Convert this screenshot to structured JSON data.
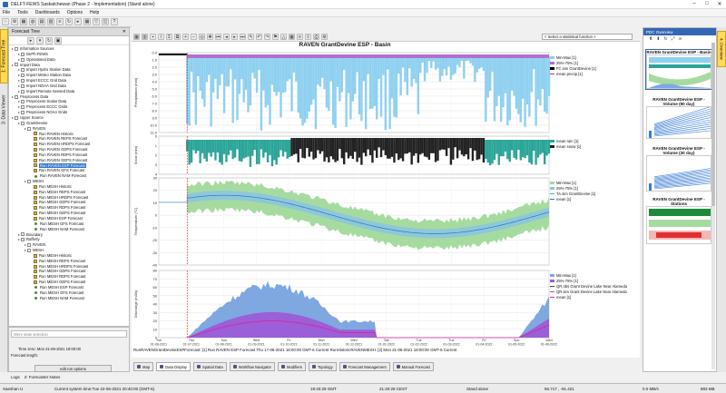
{
  "window": {
    "title": "DELFT-FEWS Saskatchewan (Phase 2 - Implementation) (Stand alone)",
    "controls": [
      "–",
      "□",
      "✕"
    ]
  },
  "menu": [
    "File",
    "Tools",
    "Dashboards",
    "Options",
    "Help"
  ],
  "left_tabs": {
    "forecast_tree": "1: Forecast Tree",
    "data_viewer": "3: Data Viewer"
  },
  "tree": {
    "header": "Forecast Tree",
    "rows": [
      {
        "d": 0,
        "t": "Information Sources"
      },
      {
        "d": 1,
        "t": "DePh-FEWS"
      },
      {
        "d": 1,
        "t": "Operational Data"
      },
      {
        "d": 0,
        "t": "Import Data"
      },
      {
        "d": 1,
        "t": "Import Hydro Station Data"
      },
      {
        "d": 1,
        "t": "Import Meteo Station Data"
      },
      {
        "d": 1,
        "t": "Import ECCC Grid Data"
      },
      {
        "d": 1,
        "t": "Import NOAA Grid Data"
      },
      {
        "d": 1,
        "t": "Import Remote Sensed Data"
      },
      {
        "d": 0,
        "t": "Preprocess Data"
      },
      {
        "d": 1,
        "t": "Preprocess Scalar Data"
      },
      {
        "d": 1,
        "t": "Preprocess ECCC Grids"
      },
      {
        "d": 1,
        "t": "Preprocess NOAA Grids"
      },
      {
        "d": 0,
        "t": "Upper Source"
      },
      {
        "d": 1,
        "t": "GrantDevine"
      },
      {
        "d": 2,
        "t": "RAVEN"
      },
      {
        "d": 3,
        "t": "Run RAVEN Historic",
        "i": 1
      },
      {
        "d": 3,
        "t": "Run RAVEN REPS Forecast",
        "i": 1
      },
      {
        "d": 3,
        "t": "Run RAVEN HRDPS Forecast",
        "i": 1
      },
      {
        "d": 3,
        "t": "Run RAVEN GDPS Forecast",
        "i": 1
      },
      {
        "d": 3,
        "t": "Run RAVEN RDPS Forecast",
        "i": 1
      },
      {
        "d": 3,
        "t": "Run RAVEN GEPS Forecast",
        "i": 1
      },
      {
        "d": 3,
        "t": "Run RAVEN ESP Forecast",
        "i": 1,
        "sel": 1
      },
      {
        "d": 3,
        "t": "Run RAVEN GFS Forecast",
        "i": 1
      },
      {
        "d": 3,
        "t": "Run RAVEN NAM Forecast",
        "dot": 1
      },
      {
        "d": 2,
        "t": "MESH"
      },
      {
        "d": 3,
        "t": "Run MESH Historic",
        "i": 1
      },
      {
        "d": 3,
        "t": "Run MESH REPS Forecast",
        "i": 1
      },
      {
        "d": 3,
        "t": "Run MESH HRDPS Forecast",
        "i": 1
      },
      {
        "d": 3,
        "t": "Run MESH GDPS Forecast",
        "i": 1
      },
      {
        "d": 3,
        "t": "Run MESH RDPS Forecast",
        "i": 1
      },
      {
        "d": 3,
        "t": "Run MESH GEPS Forecast",
        "i": 1
      },
      {
        "d": 3,
        "t": "Run MESH ESP Forecast",
        "i": 1
      },
      {
        "d": 3,
        "t": "Run MESH GFS Forecast",
        "dot": 1
      },
      {
        "d": 3,
        "t": "Run MESH NAM Forecast",
        "dot": 1
      },
      {
        "d": 1,
        "t": "Boundary"
      },
      {
        "d": 1,
        "t": "Rafferty"
      },
      {
        "d": 2,
        "t": "RAVEN"
      },
      {
        "d": 2,
        "t": "MESH"
      },
      {
        "d": 3,
        "t": "Run MESH Historic",
        "i": 1
      },
      {
        "d": 3,
        "t": "Run MESH REPS Forecast",
        "i": 1
      },
      {
        "d": 3,
        "t": "Run MESH HRDPS Forecast",
        "i": 1
      },
      {
        "d": 3,
        "t": "Run MESH GDPS Forecast",
        "i": 1
      },
      {
        "d": 3,
        "t": "Run MESH RDPS Forecast",
        "i": 1
      },
      {
        "d": 3,
        "t": "Run MESH GEPS Forecast",
        "i": 1
      },
      {
        "d": 3,
        "t": "Run MESH ESP Forecast",
        "dot": 1
      },
      {
        "d": 3,
        "t": "Run MESH GFS Forecast",
        "dot": 1
      },
      {
        "d": 3,
        "t": "Run MESH NAM Forecast",
        "dot": 1
      }
    ]
  },
  "run_panel": {
    "where_placeholder": "Were state selection",
    "time_zero": "Time zero:  Mon 21-06-2021 18:00:00",
    "forecast_length": "Forecast length:",
    "edit_button": "edit run options"
  },
  "logs_tabs": [
    "Logs",
    "2: Forecaster Notes"
  ],
  "chart_toolbar": {
    "stat_select": "< Select a statistical function >"
  },
  "chart": {
    "title": "RAVEN GrantDevine ESP - Basin",
    "footer": "RunRAVENGrantDevineESPForecast: [1] Run RAVEN ESP Forecast Thu 17-06-2021 18:00:00 GMT-6 Current RunHistoricRAVENMESH: [2] Mon 21-06-2021 18:00:00 GMT-6 Current",
    "x_ticks": [
      [
        "Tue",
        "01-06-2021"
      ],
      [
        "Thu",
        "01-07-2021"
      ],
      [
        "Sun",
        "01-08-2021"
      ],
      [
        "Wed",
        "01-09-2021"
      ],
      [
        "Fri",
        "01-10-2021"
      ],
      [
        "Mon",
        "01-11-2021"
      ],
      [
        "Wed",
        "01-12-2021"
      ],
      [
        "Sat",
        "01-01-2022"
      ],
      [
        "Tue",
        "01-02-2022"
      ],
      [
        "Tue",
        "01-03-2022"
      ],
      [
        "Fri",
        "01-04-2022"
      ],
      [
        "Sun",
        "01-05-2022"
      ],
      [
        "Wed",
        "01-06-2022"
      ]
    ],
    "panels": [
      {
        "ylabel": "Precipitation (mm)",
        "y_ticks": [
          "0.0",
          "1.0",
          "2.0",
          "3.0",
          "4.0",
          "5.0",
          "6.0",
          "7.0",
          "8.0",
          "9.0",
          "10.0",
          "11.0"
        ],
        "legend": [
          {
            "label": "Min-Max [1]",
            "color": "#8fd0f0"
          },
          {
            "label": "25%-75% [1]",
            "color": "#b36fd0"
          },
          {
            "label": "FC.sim GrantDevine [1]",
            "color": "#000000"
          },
          {
            "label": "mean precip [1]",
            "color": "#e0209a",
            "line": true
          }
        ]
      },
      {
        "ylabel": "Snow (mm)",
        "y_ticks": [
          "0",
          "1",
          "2",
          "3",
          "4"
        ],
        "legend": [
          {
            "label": "mean rain [1]",
            "color": "#2aa598"
          },
          {
            "label": "mean snow [1]",
            "color": "#222222"
          }
        ]
      },
      {
        "ylabel": "Temperature (°C)",
        "y_ticks": [
          "30",
          "20",
          "10",
          "0",
          "-10",
          "-20",
          "-30",
          "-40"
        ],
        "legend": [
          {
            "label": "Min-Max [1]",
            "color": "#a6dba0"
          },
          {
            "label": "25%-75% [1]",
            "color": "#8ec8d8"
          },
          {
            "label": "TA.sim GrantDevine [1]",
            "color": "#5aa0dc",
            "line": true
          },
          {
            "label": "mean [1]",
            "color": "#2277cc",
            "line": true
          }
        ]
      },
      {
        "ylabel": "Discharge (m3/s)",
        "y_ticks": [
          "80",
          "70",
          "60",
          "50",
          "40",
          "30",
          "20",
          "10",
          "0"
        ],
        "legend": [
          {
            "label": "Min-Max [1]",
            "color": "#7fa7e0"
          },
          {
            "label": "25%-75% [1]",
            "color": "#9b5fd8"
          },
          {
            "label": "QR.obs Grant Devine Lake Near Alameda",
            "color": "#444444",
            "line": true
          },
          {
            "label": "QR.sim Grant Devine Lake Near Alameda",
            "color": "#777777",
            "line": true
          },
          {
            "label": "mean [1]",
            "color": "#e0209a",
            "line": true
          }
        ]
      }
    ]
  },
  "view_tabs": [
    "Map",
    "Data Display",
    "Spatial Data",
    "Workflow Navigator",
    "Modifiers",
    "Topology",
    "Forecast Management",
    "Manual Forecast"
  ],
  "right_panel": {
    "header": "PDC Overview",
    "thumbs": [
      "RAVEN GrantDevine ESP - Basin",
      "RAVEN GrantDevine ESP - Volume (90 day)",
      "RAVEN GrantDevine ESP - Volume (30 day)",
      "RAVEN GrantDevine ESP - Stations"
    ]
  },
  "right_vtab": "4: Overview",
  "status": {
    "user": "Xaeshan U",
    "system_time": "Current system time:Tue 22-06-2021 20:40:00 (GMT-6)",
    "gmt": "19:40:28 GMT",
    "cest": "21:40:28 CEST",
    "mode": "Stand alone",
    "coords": "56.717 , -91.421",
    "net": "0.0 MB/s",
    "mem": "883 MB"
  },
  "colors": {
    "accent": "#3367b5",
    "precip_range": "#8fd0f0",
    "precip_iqr": "#b36fd0",
    "forecast_line": "#cc2222"
  }
}
